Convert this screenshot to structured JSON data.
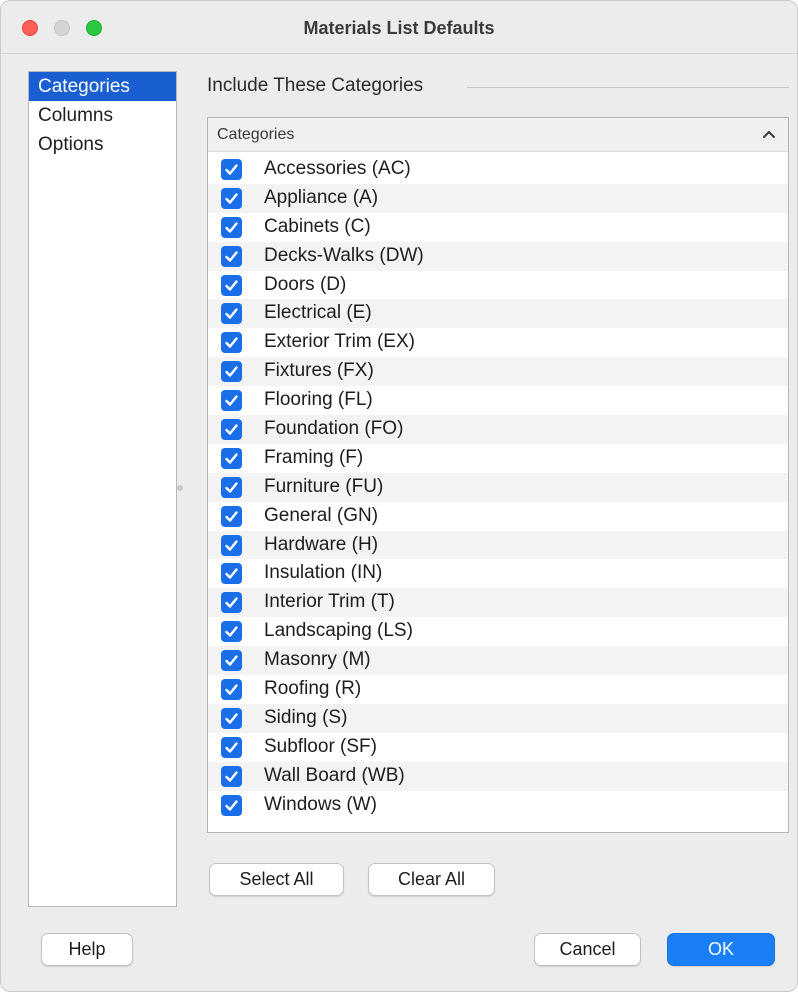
{
  "window": {
    "title": "Materials List Defaults"
  },
  "sidebar": {
    "items": [
      {
        "label": "Categories",
        "selected": true
      },
      {
        "label": "Columns",
        "selected": false
      },
      {
        "label": "Options",
        "selected": false
      }
    ]
  },
  "section": {
    "title": "Include These Categories"
  },
  "list": {
    "header": "Categories",
    "sort_icon": "chevron-up-icon",
    "rows": [
      {
        "label": "Accessories (AC)",
        "checked": true
      },
      {
        "label": "Appliance (A)",
        "checked": true
      },
      {
        "label": "Cabinets (C)",
        "checked": true
      },
      {
        "label": "Decks-Walks (DW)",
        "checked": true
      },
      {
        "label": "Doors (D)",
        "checked": true
      },
      {
        "label": "Electrical (E)",
        "checked": true
      },
      {
        "label": "Exterior Trim (EX)",
        "checked": true
      },
      {
        "label": "Fixtures (FX)",
        "checked": true
      },
      {
        "label": "Flooring (FL)",
        "checked": true
      },
      {
        "label": "Foundation (FO)",
        "checked": true
      },
      {
        "label": "Framing (F)",
        "checked": true
      },
      {
        "label": "Furniture (FU)",
        "checked": true
      },
      {
        "label": "General (GN)",
        "checked": true
      },
      {
        "label": "Hardware (H)",
        "checked": true
      },
      {
        "label": "Insulation (IN)",
        "checked": true
      },
      {
        "label": "Interior Trim (T)",
        "checked": true
      },
      {
        "label": "Landscaping (LS)",
        "checked": true
      },
      {
        "label": "Masonry (M)",
        "checked": true
      },
      {
        "label": "Roofing (R)",
        "checked": true
      },
      {
        "label": "Siding (S)",
        "checked": true
      },
      {
        "label": "Subfloor (SF)",
        "checked": true
      },
      {
        "label": "Wall Board (WB)",
        "checked": true
      },
      {
        "label": "Windows (W)",
        "checked": true
      }
    ]
  },
  "buttons": {
    "select_all": "Select All",
    "clear_all": "Clear All",
    "help": "Help",
    "cancel": "Cancel",
    "ok": "OK"
  },
  "colors": {
    "accent": "#1a7ef5",
    "selection": "#1a5fd1",
    "checkbox": "#1a6fe8"
  }
}
